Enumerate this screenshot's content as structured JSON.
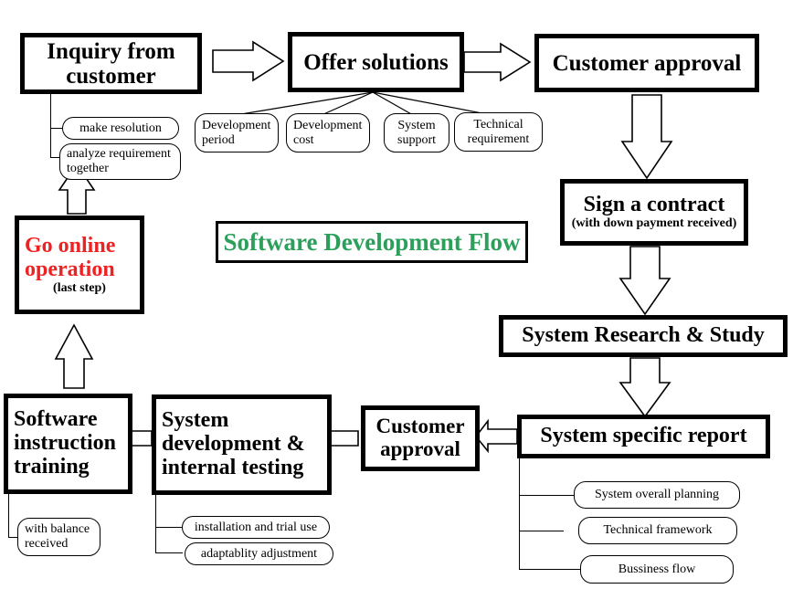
{
  "diagram": {
    "title": "Software Development Flow",
    "title_color": "#2ca05a",
    "accent_red": "#ee2222",
    "nodes": {
      "inquiry": {
        "label": "Inquiry from customer"
      },
      "offer": {
        "label": "Offer solutions"
      },
      "customer_approval_top": {
        "label": "Customer approval"
      },
      "sign_contract": {
        "title": "Sign a contract",
        "subtitle": "(with down payment received)"
      },
      "system_research": {
        "label": "System Research & Study"
      },
      "system_report": {
        "label": "System specific report"
      },
      "customer_approval_bottom": {
        "label": "Customer approval"
      },
      "system_dev": {
        "label": "System development & internal testing"
      },
      "software_training": {
        "label": "Software instruction training"
      },
      "go_online": {
        "title": "Go online operation",
        "subtitle": "(last step)"
      }
    },
    "annotations": {
      "inquiry_1": "make resolution",
      "inquiry_2": "analyze requirement together",
      "offer_1": "Development period",
      "offer_2": "Development cost",
      "offer_3": "System support",
      "offer_4": "Technical requirement",
      "report_1": "System overall planning",
      "report_2": "Technical framework",
      "report_3": "Bussiness flow",
      "dev_1": "installation and trial use",
      "dev_2": "adaptablity adjustment",
      "training_1": "with balance received"
    }
  }
}
